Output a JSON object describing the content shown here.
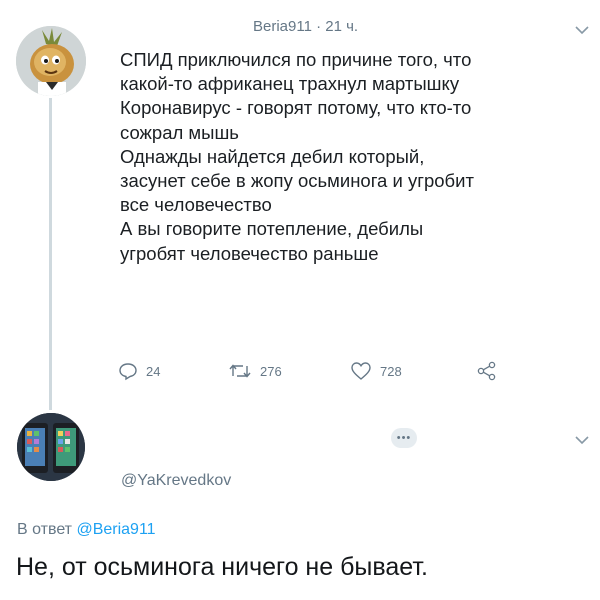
{
  "tweet": {
    "header": "Beria911 · 21 ч.",
    "lines": [
      "СПИД приключился  по причине того, что",
      "какой-то африканец трахнул мартышку",
      "Коронавирус - говорят потому, что кто-то",
      "сожрал мышь",
      "Однажды найдется дебил который,",
      "засунет себе в жопу осьминога и угробит",
      "все человечество",
      "А вы говорите потепление, дебилы",
      "угробят человечество раньше"
    ],
    "actions": {
      "replies": "24",
      "retweets": "276",
      "likes": "728"
    }
  },
  "reply": {
    "badge": "•••",
    "handle": "@YaKrevedkov",
    "reply_to_prefix": "В ответ ",
    "reply_to_mention": "@Beria911",
    "text": "Не, от осьминога ничего не бывает."
  },
  "colors": {
    "muted": "#657786",
    "link": "#1da1f2",
    "text": "#14171a"
  },
  "icons": [
    "reply-icon",
    "retweet-icon",
    "like-icon",
    "share-icon",
    "chevron-down-icon"
  ]
}
